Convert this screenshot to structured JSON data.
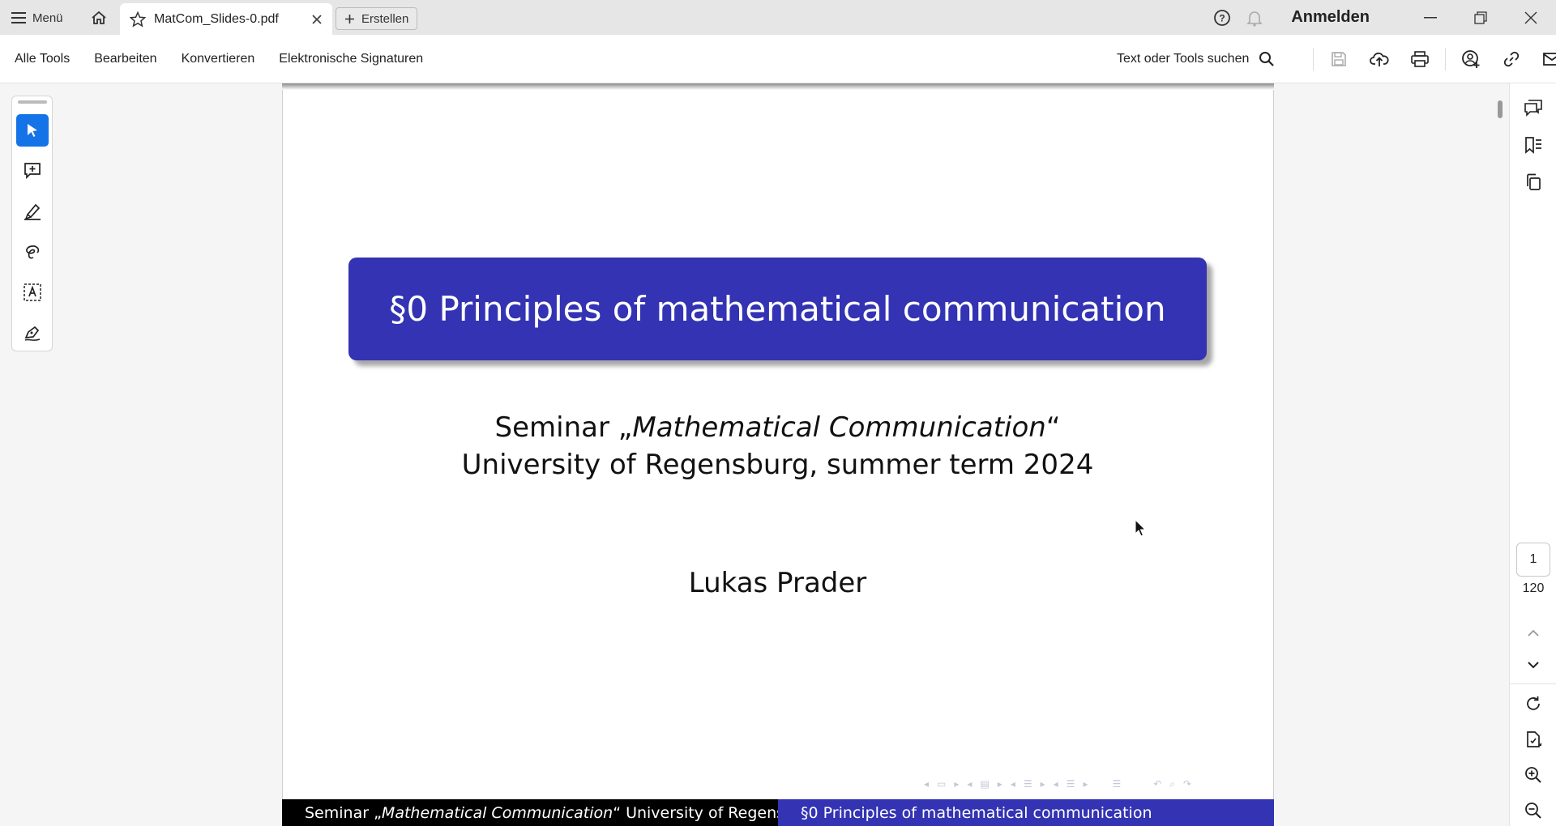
{
  "titlebar": {
    "menu_label": "Menü",
    "tab_title": "MatCom_Slides-0.pdf",
    "create_label": "Erstellen",
    "login_label": "Anmelden",
    "icons": [
      "menu-icon",
      "home-icon",
      "star-icon",
      "close-icon",
      "plus-icon",
      "help-icon",
      "bell-icon",
      "minimize-icon",
      "restore-icon",
      "window-close-icon"
    ]
  },
  "toolbar": {
    "menu_items": [
      "Alle Tools",
      "Bearbeiten",
      "Konvertieren",
      "Elektronische Signaturen"
    ],
    "search_label": "Text oder Tools suchen",
    "icons": [
      "search-icon",
      "save-icon",
      "upload-icon",
      "print-icon",
      "share-user-icon",
      "link-icon",
      "mail-icon"
    ]
  },
  "left_rail": {
    "tools": [
      "select-icon",
      "add-comment-icon",
      "highlight-pen-icon",
      "draw-freeform-icon",
      "text-box-icon",
      "sign-icon"
    ],
    "active_tool": "select-icon",
    "accent_color": "#1473e6"
  },
  "slide": {
    "title": "§0 Principles of mathematical communication",
    "subtitle_prefix": "Seminar „",
    "subtitle_italic": "Mathematical Communication",
    "subtitle_suffix": "“",
    "subtitle_line2": "University of Regensburg, summer term 2024",
    "author": "Lukas Prader",
    "footer_left_prefix": "Seminar „",
    "footer_left_italic": "Mathematical Communication",
    "footer_left_suffix": "“ University of Regensburg",
    "footer_right": "§0 Principles of mathematical communication",
    "theme_color": "#3333b3"
  },
  "right_rail": {
    "icons": [
      "comments-icon",
      "bookmark-icon",
      "pages-icon",
      "chevron-up-icon",
      "chevron-down-icon",
      "rotate-icon",
      "page-settings-icon",
      "zoom-in-icon",
      "zoom-out-icon"
    ],
    "current_page": "1",
    "total_pages": "120"
  }
}
